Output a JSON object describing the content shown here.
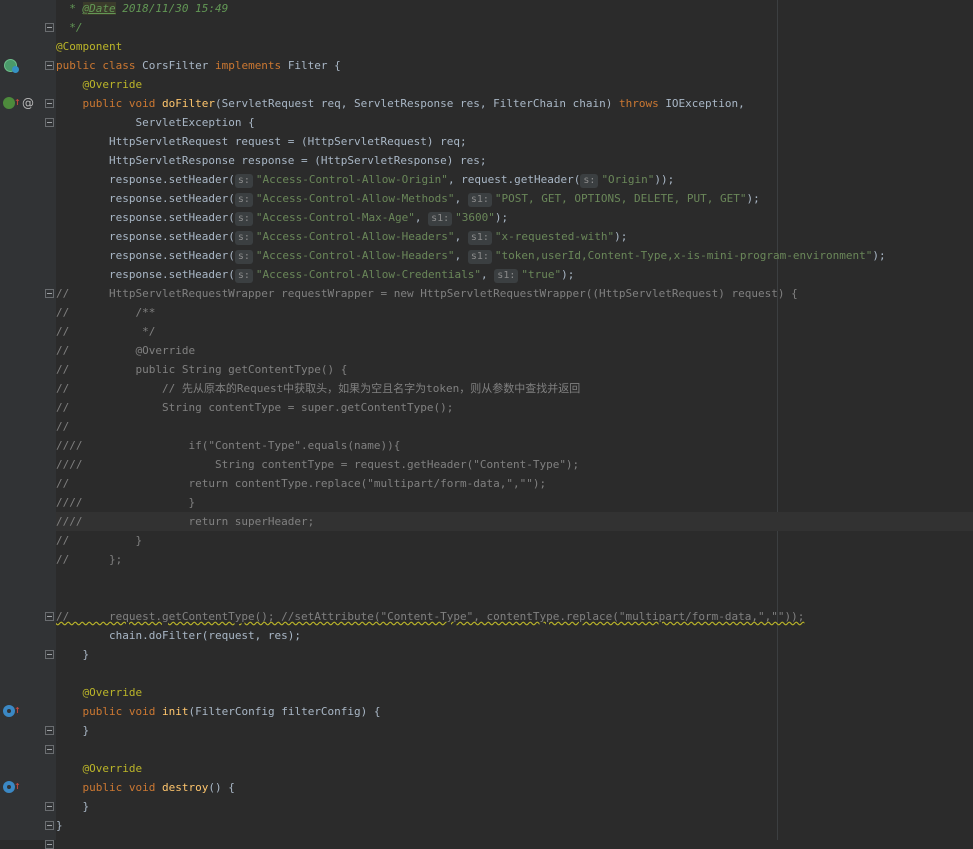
{
  "editor": {
    "theme": "Darcula",
    "colors": {
      "background": "#2b2b2b",
      "gutter": "#313335",
      "keyword": "#cc7832",
      "method": "#ffc66d",
      "string": "#6a8759",
      "annotation": "#bbb529",
      "comment": "#808080"
    },
    "gutter_icons": [
      {
        "row": 3,
        "icon": "implementation-class-icon"
      },
      {
        "row": 5,
        "icon": "override-up-arrow-icon"
      },
      {
        "row": 5,
        "icon": "at-annotation-icon"
      },
      {
        "row": 37,
        "icon": "override-circle-icon"
      },
      {
        "row": 41,
        "icon": "override-circle-icon"
      }
    ],
    "lines": [
      {
        "indent": "  ",
        "tokens": [
          {
            "t": "* ",
            "c": "doc"
          },
          {
            "t": "@Date",
            "c": "doc-tag"
          },
          {
            "t": " 2018/11/30 15:49",
            "c": "doc"
          }
        ]
      },
      {
        "indent": "  ",
        "tokens": [
          {
            "t": "*/",
            "c": "doc"
          }
        ]
      },
      {
        "indent": "",
        "tokens": [
          {
            "t": "@Component",
            "c": "ann"
          }
        ]
      },
      {
        "indent": "",
        "tokens": [
          {
            "t": "public class ",
            "c": "kw"
          },
          {
            "t": "CorsFilter ",
            "c": ""
          },
          {
            "t": "implements ",
            "c": "kw"
          },
          {
            "t": "Filter {",
            "c": ""
          }
        ]
      },
      {
        "indent": "    ",
        "tokens": [
          {
            "t": "@Override",
            "c": "ann"
          }
        ]
      },
      {
        "indent": "    ",
        "tokens": [
          {
            "t": "public void ",
            "c": "kw"
          },
          {
            "t": "doFilter",
            "c": "fn"
          },
          {
            "t": "(ServletRequest req, ServletResponse res, FilterChain chain) ",
            "c": ""
          },
          {
            "t": "throws ",
            "c": "kw"
          },
          {
            "t": "IOException,",
            "c": ""
          }
        ]
      },
      {
        "indent": "            ",
        "tokens": [
          {
            "t": "ServletException {",
            "c": ""
          }
        ]
      },
      {
        "indent": "        ",
        "tokens": [
          {
            "t": "HttpServletRequest request = (HttpServletRequest) req;",
            "c": ""
          }
        ]
      },
      {
        "indent": "        ",
        "tokens": [
          {
            "t": "HttpServletResponse response = (HttpServletResponse) res;",
            "c": ""
          }
        ]
      },
      {
        "indent": "        ",
        "tokens": [
          {
            "t": "response.setHeader(",
            "c": ""
          },
          {
            "t": "s:",
            "c": "hint"
          },
          {
            "t": "\"Access-Control-Allow-Origin\"",
            "c": "str"
          },
          {
            "t": ", request.getHeader(",
            "c": ""
          },
          {
            "t": "s:",
            "c": "hint"
          },
          {
            "t": "\"Origin\"",
            "c": "str"
          },
          {
            "t": "));",
            "c": ""
          }
        ]
      },
      {
        "indent": "        ",
        "tokens": [
          {
            "t": "response.setHeader(",
            "c": ""
          },
          {
            "t": "s:",
            "c": "hint"
          },
          {
            "t": "\"Access-Control-Allow-Methods\"",
            "c": "str"
          },
          {
            "t": ", ",
            "c": ""
          },
          {
            "t": "s1:",
            "c": "hint"
          },
          {
            "t": "\"POST, GET, OPTIONS, DELETE, PUT, GET\"",
            "c": "str"
          },
          {
            "t": ");",
            "c": ""
          }
        ]
      },
      {
        "indent": "        ",
        "tokens": [
          {
            "t": "response.setHeader(",
            "c": ""
          },
          {
            "t": "s:",
            "c": "hint"
          },
          {
            "t": "\"Access-Control-Max-Age\"",
            "c": "str"
          },
          {
            "t": ", ",
            "c": ""
          },
          {
            "t": "s1:",
            "c": "hint"
          },
          {
            "t": "\"3600\"",
            "c": "str"
          },
          {
            "t": ");",
            "c": ""
          }
        ]
      },
      {
        "indent": "        ",
        "tokens": [
          {
            "t": "response.setHeader(",
            "c": ""
          },
          {
            "t": "s:",
            "c": "hint"
          },
          {
            "t": "\"Access-Control-Allow-Headers\"",
            "c": "str"
          },
          {
            "t": ", ",
            "c": ""
          },
          {
            "t": "s1:",
            "c": "hint"
          },
          {
            "t": "\"x-requested-with\"",
            "c": "str"
          },
          {
            "t": ");",
            "c": ""
          }
        ]
      },
      {
        "indent": "        ",
        "tokens": [
          {
            "t": "response.setHeader(",
            "c": ""
          },
          {
            "t": "s:",
            "c": "hint"
          },
          {
            "t": "\"Access-Control-Allow-Headers\"",
            "c": "str"
          },
          {
            "t": ", ",
            "c": ""
          },
          {
            "t": "s1:",
            "c": "hint"
          },
          {
            "t": "\"token,userId,Content-Type,x-is-mini-program-environment\"",
            "c": "str"
          },
          {
            "t": ");",
            "c": ""
          }
        ]
      },
      {
        "indent": "        ",
        "tokens": [
          {
            "t": "response.setHeader(",
            "c": ""
          },
          {
            "t": "s:",
            "c": "hint"
          },
          {
            "t": "\"Access-Control-Allow-Credentials\"",
            "c": "str"
          },
          {
            "t": ", ",
            "c": ""
          },
          {
            "t": "s1:",
            "c": "hint"
          },
          {
            "t": "\"true\"",
            "c": "str"
          },
          {
            "t": ");",
            "c": ""
          }
        ]
      },
      {
        "indent": "",
        "tokens": [
          {
            "t": "//      HttpServletRequestWrapper requestWrapper = new HttpServletRequestWrapper((HttpServletRequest) request) {",
            "c": "cm"
          }
        ]
      },
      {
        "indent": "",
        "tokens": [
          {
            "t": "//          /**",
            "c": "cm"
          }
        ]
      },
      {
        "indent": "",
        "tokens": [
          {
            "t": "//           */",
            "c": "cm"
          }
        ]
      },
      {
        "indent": "",
        "tokens": [
          {
            "t": "//          @Override",
            "c": "cm"
          }
        ]
      },
      {
        "indent": "",
        "tokens": [
          {
            "t": "//          public String getContentType() {",
            "c": "cm"
          }
        ]
      },
      {
        "indent": "",
        "tokens": [
          {
            "t": "//              // 先从原本的Request中获取头，如果为空且名字为token，则从参数中查找并返回",
            "c": "cm"
          }
        ]
      },
      {
        "indent": "",
        "tokens": [
          {
            "t": "//              String contentType = super.getContentType();",
            "c": "cm"
          }
        ]
      },
      {
        "indent": "",
        "tokens": [
          {
            "t": "//",
            "c": "cm"
          }
        ]
      },
      {
        "indent": "",
        "tokens": [
          {
            "t": "////                if(\"Content-Type\".equals(name)){",
            "c": "cm"
          }
        ]
      },
      {
        "indent": "",
        "tokens": [
          {
            "t": "////                    String contentType = request.getHeader(\"Content-Type\");",
            "c": "cm"
          }
        ]
      },
      {
        "indent": "",
        "tokens": [
          {
            "t": "//                  return contentType.replace(\"multipart/form-data,\",\"\");",
            "c": "cm"
          }
        ]
      },
      {
        "indent": "",
        "tokens": [
          {
            "t": "////                }",
            "c": "cm"
          }
        ]
      },
      {
        "indent": "",
        "tokens": [
          {
            "t": "////                return superHeader;",
            "c": "cm"
          }
        ],
        "highlight": true
      },
      {
        "indent": "",
        "tokens": [
          {
            "t": "//          }",
            "c": "cm"
          }
        ]
      },
      {
        "indent": "",
        "tokens": [
          {
            "t": "//      };",
            "c": "cm"
          }
        ]
      },
      {
        "indent": "",
        "tokens": []
      },
      {
        "indent": "",
        "tokens": []
      },
      {
        "indent": "",
        "tokens": [
          {
            "t": "//      request.getContentType(); //setAttribute(\"Content-Type\", contentType.replace(\"multipart/form-data,\",\"\"));",
            "c": "cm squiggle"
          }
        ]
      },
      {
        "indent": "        ",
        "tokens": [
          {
            "t": "chain.doFilter(request, res);",
            "c": ""
          }
        ]
      },
      {
        "indent": "    ",
        "tokens": [
          {
            "t": "}",
            "c": ""
          }
        ]
      },
      {
        "indent": "",
        "tokens": []
      },
      {
        "indent": "    ",
        "tokens": [
          {
            "t": "@Override",
            "c": "ann"
          }
        ]
      },
      {
        "indent": "    ",
        "tokens": [
          {
            "t": "public void ",
            "c": "kw"
          },
          {
            "t": "init",
            "c": "fn"
          },
          {
            "t": "(FilterConfig filterConfig) {",
            "c": ""
          }
        ]
      },
      {
        "indent": "    ",
        "tokens": [
          {
            "t": "}",
            "c": ""
          }
        ]
      },
      {
        "indent": "",
        "tokens": []
      },
      {
        "indent": "    ",
        "tokens": [
          {
            "t": "@Override",
            "c": "ann"
          }
        ]
      },
      {
        "indent": "    ",
        "tokens": [
          {
            "t": "public void ",
            "c": "kw"
          },
          {
            "t": "destroy",
            "c": "fn"
          },
          {
            "t": "() {",
            "c": ""
          }
        ]
      },
      {
        "indent": "    ",
        "tokens": [
          {
            "t": "}",
            "c": ""
          }
        ]
      },
      {
        "indent": "",
        "tokens": [
          {
            "t": "}",
            "c": ""
          }
        ]
      }
    ]
  }
}
